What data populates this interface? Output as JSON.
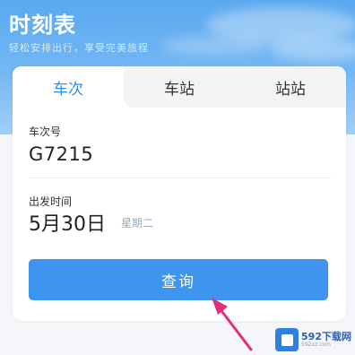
{
  "header": {
    "title": "时刻表",
    "subtitle": "轻松安排出行，享受完美旅程"
  },
  "tabs": [
    {
      "label": "车次",
      "active": true
    },
    {
      "label": "车站",
      "active": false
    },
    {
      "label": "站站",
      "active": false
    }
  ],
  "train_number": {
    "label": "车次号",
    "value": "G7215"
  },
  "departure": {
    "label": "出发时间",
    "date": "5月30日",
    "weekday": "星期二"
  },
  "query_button": {
    "label": "查询"
  },
  "watermark": {
    "site": "592下载网"
  },
  "colors": {
    "accent": "#3d95f0",
    "header": "#5aa8ef",
    "annotation_arrow": "#e0307a"
  }
}
